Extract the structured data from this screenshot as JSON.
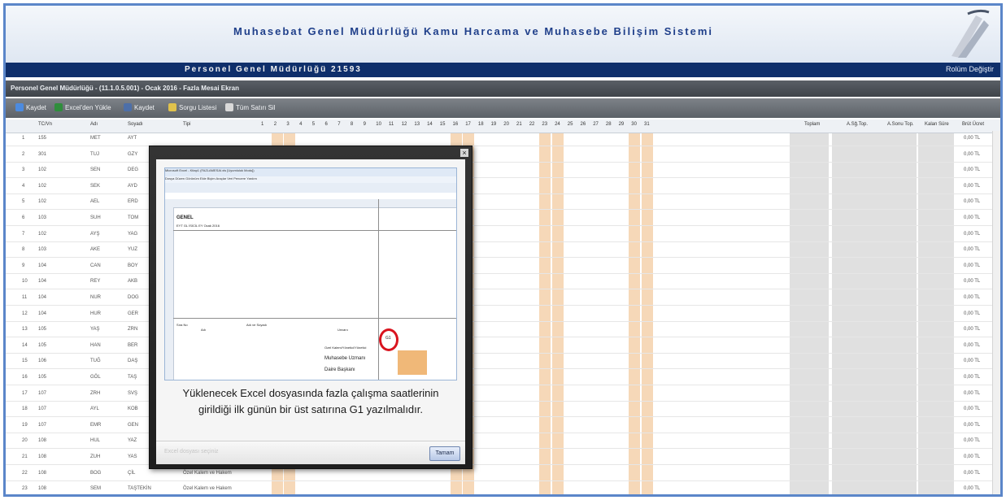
{
  "app": {
    "title": "Muhasebat Genel Müdürlüğü Kamu Harcama ve Muhasebe Bilişim Sistemi",
    "nav_title": "Personel Genel Müdürlüğü  21593",
    "nav_link": "Rolüm Değiştir"
  },
  "breadcrumb": "Personel Genel Müdürlüğü - (11.1.0.5.001) - Ocak 2016 - Fazla Mesai Ekran",
  "toolbar": [
    {
      "label": "Kaydet",
      "icon": "save-icon",
      "color": "#4c8be0"
    },
    {
      "label": "Excel'den Yükle",
      "icon": "upload-icon",
      "color": "#2f8e3c"
    },
    {
      "label": "Kaydet",
      "icon": "print-icon",
      "color": "#4d6fa8"
    },
    {
      "label": "Sorgu Listesi",
      "icon": "list-icon",
      "color": "#e0c24c"
    },
    {
      "label": "Tüm Satırı Sil",
      "icon": "delete-icon",
      "color": "#d9d9d9"
    }
  ],
  "grid": {
    "headers": [
      "TC/Vn",
      "Adı",
      "Soyadı",
      "Tipi",
      "Toplam",
      "A.Sğ.Top.",
      "A.Sonu Top.",
      "Kalan Süre",
      "Brüt Ücret"
    ],
    "day_headers": [
      "1",
      "2",
      "3",
      "4",
      "5",
      "6",
      "7",
      "8",
      "9",
      "10",
      "11",
      "12",
      "13",
      "14",
      "15",
      "16",
      "17",
      "18",
      "19",
      "20",
      "21",
      "22",
      "23",
      "24",
      "25",
      "26",
      "27",
      "28",
      "29",
      "30",
      "31"
    ],
    "rows": [
      {
        "no": "1",
        "tc": "155",
        "ad": "MET",
        "soyad": "AYT",
        "tip": "",
        "brut": "0,00 TL"
      },
      {
        "no": "2",
        "tc": "301",
        "ad": "TUJ",
        "soyad": "GZY",
        "tip": "",
        "brut": "0,00 TL"
      },
      {
        "no": "3",
        "tc": "102",
        "ad": "SEN",
        "soyad": "DEG",
        "tip": "",
        "brut": "0,00 TL"
      },
      {
        "no": "4",
        "tc": "102",
        "ad": "SEK",
        "soyad": "AYD",
        "tip": "",
        "brut": "0,00 TL"
      },
      {
        "no": "5",
        "tc": "102",
        "ad": "AEL",
        "soyad": "ERD",
        "tip": "",
        "brut": "0,00 TL"
      },
      {
        "no": "6",
        "tc": "103",
        "ad": "SUH",
        "soyad": "TOM",
        "tip": "",
        "brut": "0,00 TL"
      },
      {
        "no": "7",
        "tc": "102",
        "ad": "AYŞ",
        "soyad": "YAG",
        "tip": "",
        "brut": "0,00 TL"
      },
      {
        "no": "8",
        "tc": "103",
        "ad": "AKE",
        "soyad": "YUZ",
        "tip": "",
        "brut": "0,00 TL"
      },
      {
        "no": "9",
        "tc": "104",
        "ad": "CAN",
        "soyad": "BOY",
        "tip": "",
        "brut": "0,00 TL"
      },
      {
        "no": "10",
        "tc": "104",
        "ad": "REY",
        "soyad": "AKB",
        "tip": "",
        "brut": "0,00 TL"
      },
      {
        "no": "11",
        "tc": "104",
        "ad": "NUR",
        "soyad": "DOG",
        "tip": "",
        "brut": "0,00 TL"
      },
      {
        "no": "12",
        "tc": "104",
        "ad": "HUR",
        "soyad": "GER",
        "tip": "",
        "brut": "0,00 TL"
      },
      {
        "no": "13",
        "tc": "105",
        "ad": "YAŞ",
        "soyad": "ZRN",
        "tip": "",
        "brut": "0,00 TL"
      },
      {
        "no": "14",
        "tc": "105",
        "ad": "HAN",
        "soyad": "BER",
        "tip": "",
        "brut": "0,00 TL"
      },
      {
        "no": "15",
        "tc": "106",
        "ad": "TUĞ",
        "soyad": "DAŞ",
        "tip": "",
        "brut": "0,00 TL"
      },
      {
        "no": "16",
        "tc": "105",
        "ad": "GÖL",
        "soyad": "TAŞ",
        "tip": "",
        "brut": "0,00 TL"
      },
      {
        "no": "17",
        "tc": "107",
        "ad": "ZRH",
        "soyad": "SVŞ",
        "tip": "",
        "brut": "0,00 TL"
      },
      {
        "no": "18",
        "tc": "107",
        "ad": "AYL",
        "soyad": "KOB",
        "tip": "",
        "brut": "0,00 TL"
      },
      {
        "no": "19",
        "tc": "107",
        "ad": "EMR",
        "soyad": "GEN",
        "tip": "",
        "brut": "0,00 TL"
      },
      {
        "no": "20",
        "tc": "108",
        "ad": "HUL",
        "soyad": "YAZ",
        "tip": "",
        "brut": "0,00 TL"
      },
      {
        "no": "21",
        "tc": "108",
        "ad": "ZUH",
        "soyad": "YAS",
        "tip": "",
        "brut": "0,00 TL"
      },
      {
        "no": "22",
        "tc": "108",
        "ad": "BOG",
        "soyad": "ÇİL",
        "tip": "Özel Kalem ve Hakem",
        "brut": "0,00 TL"
      },
      {
        "no": "23",
        "tc": "108",
        "ad": "SEM",
        "soyad": "TAŞTEKİN",
        "tip": "Özel Kalem ve Hakem",
        "brut": "0,00 TL"
      }
    ]
  },
  "dialog": {
    "excel_title": "Microsoft Excel - Kitap1 (FAZLAMESAI.xls [Uyumluluk Modu])",
    "excel_menu": "Dosya  Düzen  Görünüm  Ekle  Biçim  Araçlar  Veri  Pencere  Yardım",
    "excel_header1": "GENEL",
    "excel_header2": "EYT GL İSİCİL EY   Ocak 2016",
    "excel_col_a": "Sıra No",
    "excel_col_b": "Adı",
    "excel_col_c": "Adı ve Soyadı",
    "excel_col_d": "Unvanı",
    "excel_g1": "G1",
    "excel_r1": "Ozel Kalem/Yönetici/Yönetici",
    "excel_r2": "Muhasebe Uzmanı",
    "excel_r3": "Daire Başkanı",
    "caption": "Yüklenecek Excel dosyasında fazla çalışma saatlerinin girildiği ilk günün bir üst satırına G1 yazılmalıdır.",
    "footer_hint": "Excel dosyası seçiniz",
    "ok_label": "Tamam",
    "close_label": "×"
  },
  "colors": {
    "accent": "#0f2f6b",
    "weekend": "#f6d8b8",
    "summary": "#e0e0e0",
    "circle": "#d9141f"
  }
}
